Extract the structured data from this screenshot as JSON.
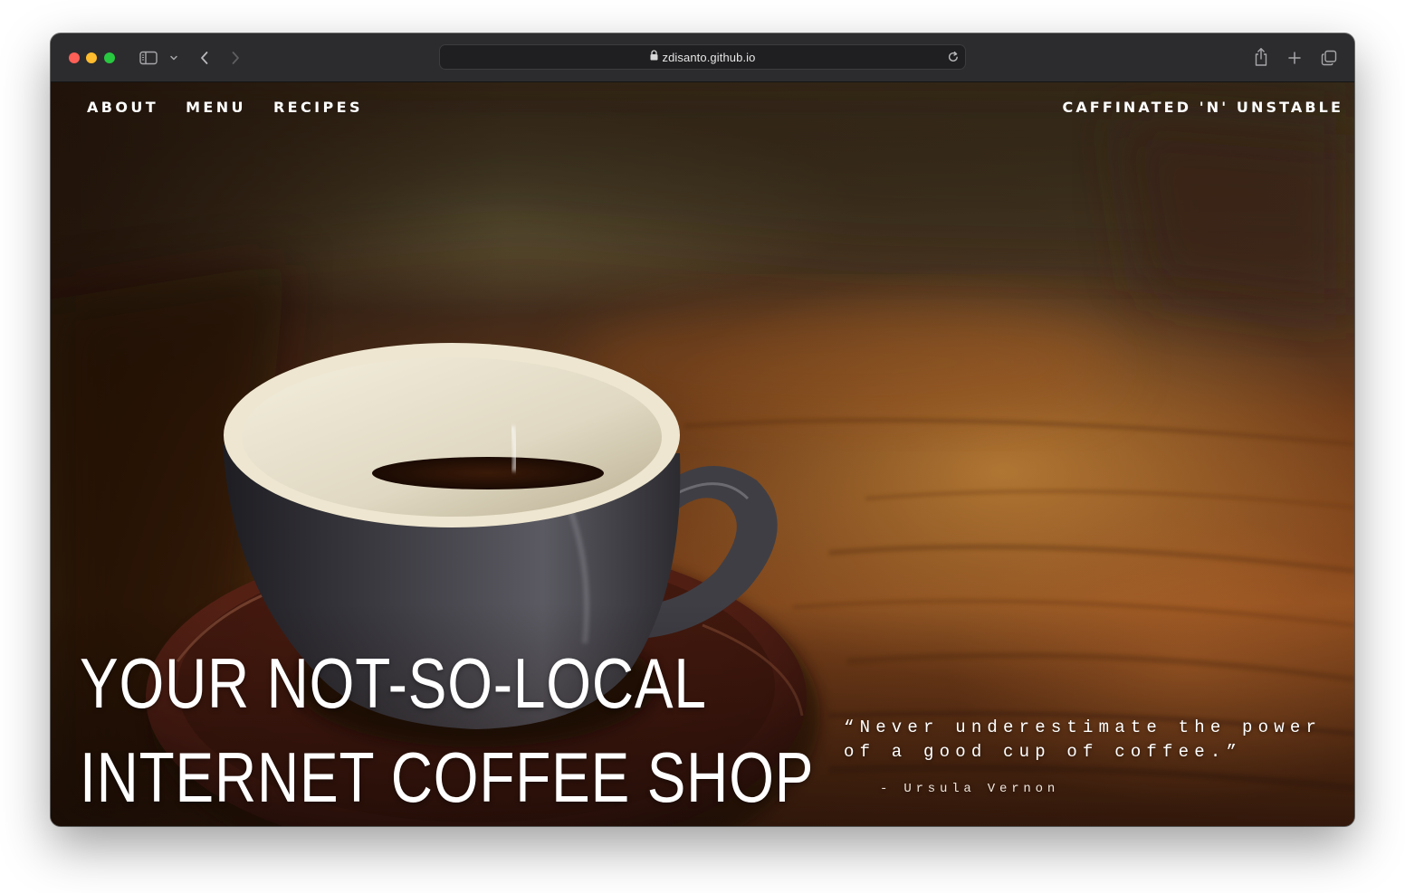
{
  "browser": {
    "url": "zdisanto.github.io",
    "icons": {
      "sidebar": "sidebar-icon",
      "sidebar_menu": "chevron-down-icon",
      "back": "chevron-left-icon",
      "forward": "chevron-right-icon",
      "lock": "lock-icon",
      "reload": "reload-icon",
      "share": "share-icon",
      "new_tab": "plus-icon",
      "tabs": "tabs-overview-icon"
    }
  },
  "nav": {
    "items": [
      {
        "label": "ABOUT"
      },
      {
        "label": "MENU"
      },
      {
        "label": "RECIPES"
      }
    ],
    "brand": "CAFFINATED 'N' UNSTABLE"
  },
  "hero": {
    "headline_line1": "YOUR NOT-SO-LOCAL",
    "headline_line2": "INTERNET COFFEE SHOP",
    "quote_line1": "“Never underestimate the power",
    "quote_line2": "of a good cup of coffee.”",
    "quote_author": "- Ursula Vernon"
  },
  "colors": {
    "chrome": "#2c2c2e",
    "traffic_red": "#fe5f57",
    "traffic_yellow": "#febc2e",
    "traffic_green": "#28c840",
    "text": "#ffffff"
  }
}
